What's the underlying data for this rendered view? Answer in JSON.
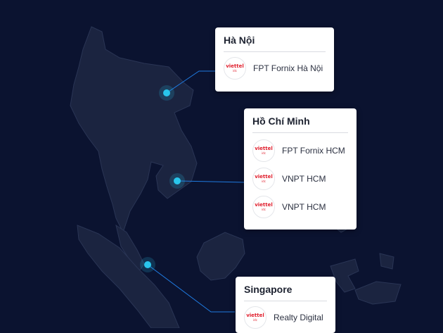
{
  "colors": {
    "background": "#0b1330",
    "land": "#1b2440",
    "marker": "#29c6ec",
    "connector": "#1f7ae0"
  },
  "logo": {
    "brand": "viettel",
    "sub": "idc"
  },
  "regions": [
    {
      "title": "Hà Nội",
      "items": [
        "FPT Fornix Hà Nội"
      ]
    },
    {
      "title": "Hồ Chí Minh",
      "items": [
        "FPT Fornix HCM",
        "VNPT HCM",
        "VNPT HCM"
      ]
    },
    {
      "title": "Singapore",
      "items": [
        "Realty Digital"
      ]
    }
  ]
}
